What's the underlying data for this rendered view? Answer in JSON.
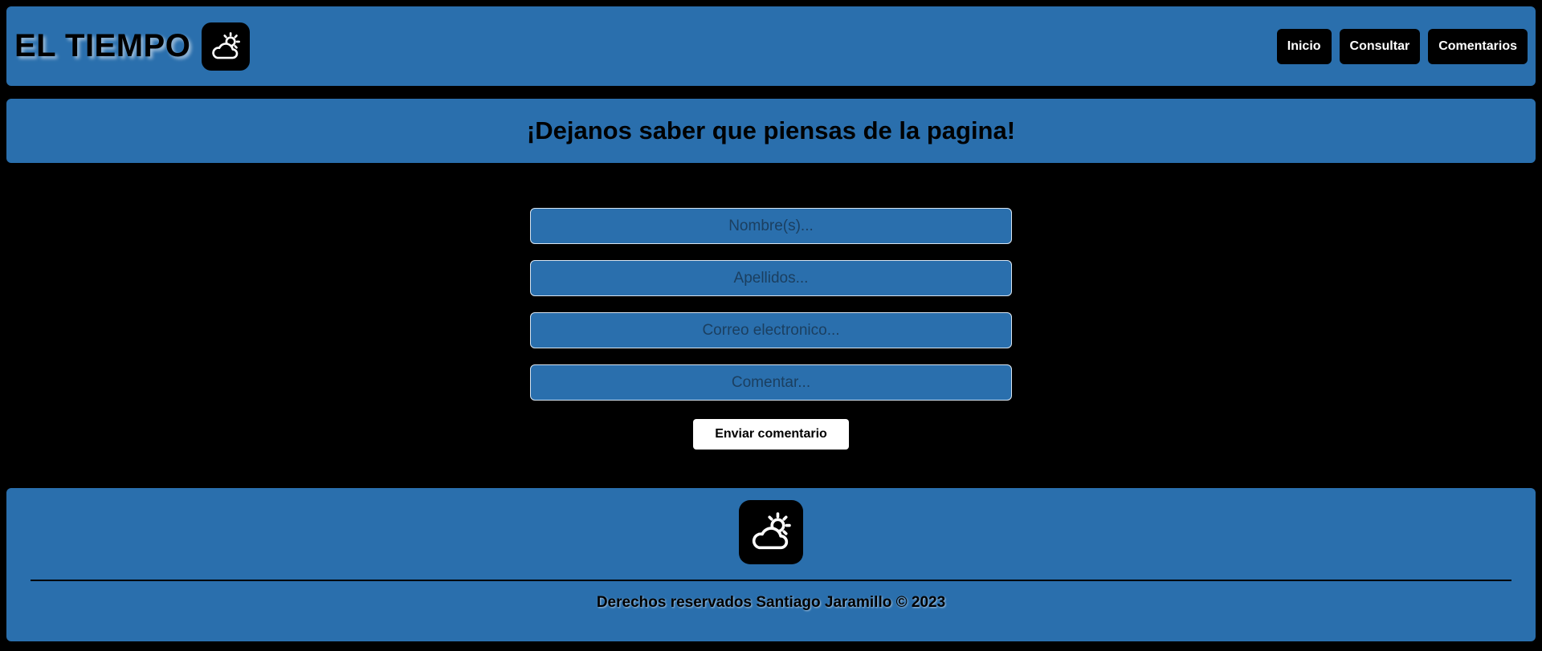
{
  "header": {
    "title": "EL TIEMPO",
    "logo_icon": "cloud-sun-icon",
    "nav": [
      {
        "label": "Inicio"
      },
      {
        "label": "Consultar"
      },
      {
        "label": "Comentarios"
      }
    ]
  },
  "banner": {
    "heading": "¡Dejanos saber que piensas de la pagina!"
  },
  "form": {
    "first_name_placeholder": "Nombre(s)...",
    "last_name_placeholder": "Apellidos...",
    "email_placeholder": "Correo electronico...",
    "comment_placeholder": "Comentar...",
    "submit_label": "Enviar comentario"
  },
  "footer": {
    "logo_icon": "cloud-sun-icon",
    "copyright": "Derechos reservados Santiago Jaramillo © 2023"
  },
  "colors": {
    "accent": "#2a6fad",
    "background": "#000000"
  }
}
